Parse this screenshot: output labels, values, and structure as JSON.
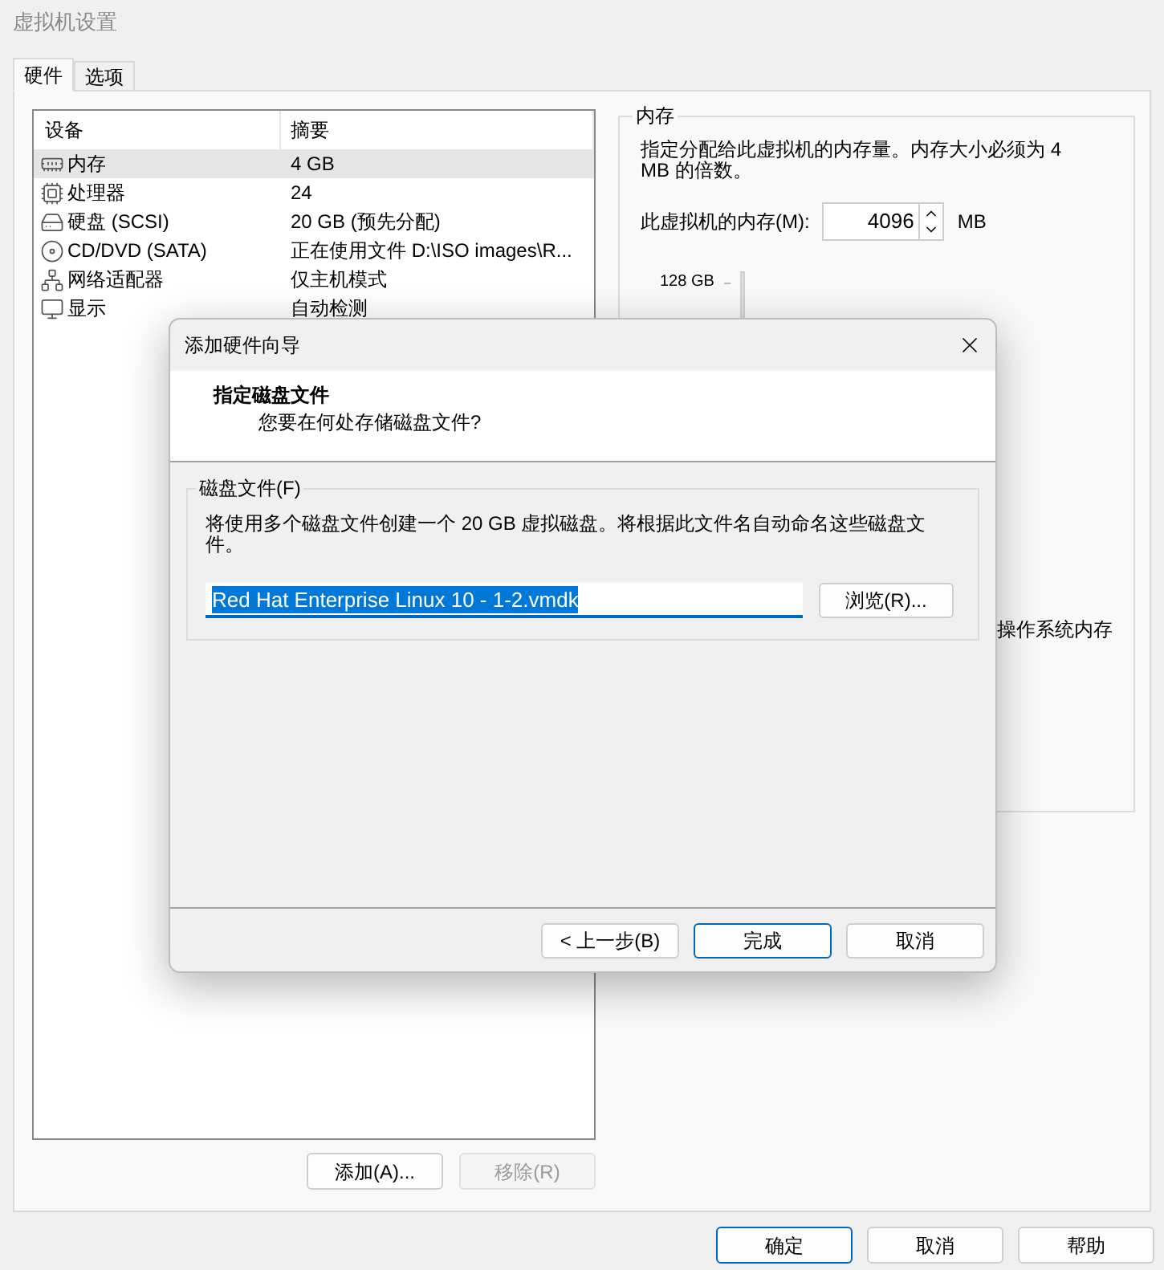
{
  "window": {
    "title": "虚拟机设置"
  },
  "tabs": [
    {
      "label": "硬件",
      "selected": true
    },
    {
      "label": "选项",
      "selected": false
    }
  ],
  "device_list": {
    "columns": [
      "设备",
      "摘要"
    ],
    "rows": [
      {
        "kind": "memory",
        "device": "内存",
        "summary": "4 GB",
        "selected": true
      },
      {
        "kind": "cpu",
        "device": "处理器",
        "summary": "24",
        "selected": false
      },
      {
        "kind": "disk",
        "device": "硬盘 (SCSI)",
        "summary": "20 GB (预先分配)",
        "selected": false
      },
      {
        "kind": "cd",
        "device": "CD/DVD (SATA)",
        "summary": "正在使用文件 D:\\ISO images\\R...",
        "selected": false
      },
      {
        "kind": "network",
        "device": "网络适配器",
        "summary": "仅主机模式",
        "selected": false
      },
      {
        "kind": "display",
        "device": "显示",
        "summary": "自动检测",
        "selected": false
      }
    ]
  },
  "list_buttons": [
    {
      "label": "添加(A)...",
      "disabled": false
    },
    {
      "label": "移除(R)",
      "disabled": true
    }
  ],
  "memory_panel": {
    "title": "内存",
    "description": "指定分配给此虚拟机的内存量。内存大小必须为 4 MB 的倍数。",
    "memory_label": "此虚拟机的内存(M):",
    "memory_value": "4096",
    "unit": "MB",
    "slider_top_label": "128 GB",
    "partial_text": "操作系统内存"
  },
  "dialog": {
    "title": "添加硬件向导",
    "heading": "指定磁盘文件",
    "subheading": "您要在何处存储磁盘文件?",
    "group_label": "磁盘文件(F)",
    "info": "将使用多个磁盘文件创建一个 20 GB 虚拟磁盘。将根据此文件名自动命名这些磁盘文件。",
    "file_name": "Red Hat Enterprise Linux 10 - 1-2.vmdk",
    "browse_button": "浏览(R)...",
    "buttons": [
      {
        "label": "< 上一步(B)",
        "default": false
      },
      {
        "label": "完成",
        "default": true
      },
      {
        "label": "取消",
        "default": false
      }
    ]
  },
  "buttons": [
    {
      "label": "确定",
      "default": true
    },
    {
      "label": "取消",
      "default": false
    },
    {
      "label": "帮助",
      "default": false
    }
  ]
}
